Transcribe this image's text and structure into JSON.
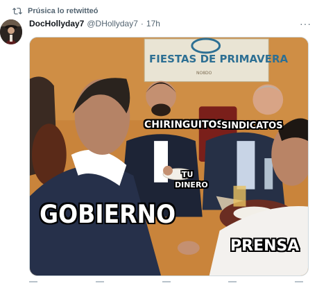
{
  "retweet": {
    "icon": "retweet-icon",
    "text": "Prúsica lo retwitteó"
  },
  "author": {
    "display_name": "DocHollyday7",
    "handle": "@DHollyday7",
    "separator": "·",
    "timestamp": "17h",
    "more_label": "···"
  },
  "media": {
    "poster_title": "FIESTAS DE PRIMAVERA",
    "poster_subtitle": "NO8DO",
    "labels": {
      "chiringuitos": "CHIRINGUITOS",
      "sindicatos": "SINDICATOS",
      "tu": "TU",
      "dinero": "DINERO",
      "gobierno": "GOBIERNO",
      "prensa": "PRENSA"
    }
  },
  "colors": {
    "text_primary": "#0f1419",
    "text_secondary": "#536471",
    "wall": "#c9843b",
    "poster_text": "#2d6f93"
  }
}
